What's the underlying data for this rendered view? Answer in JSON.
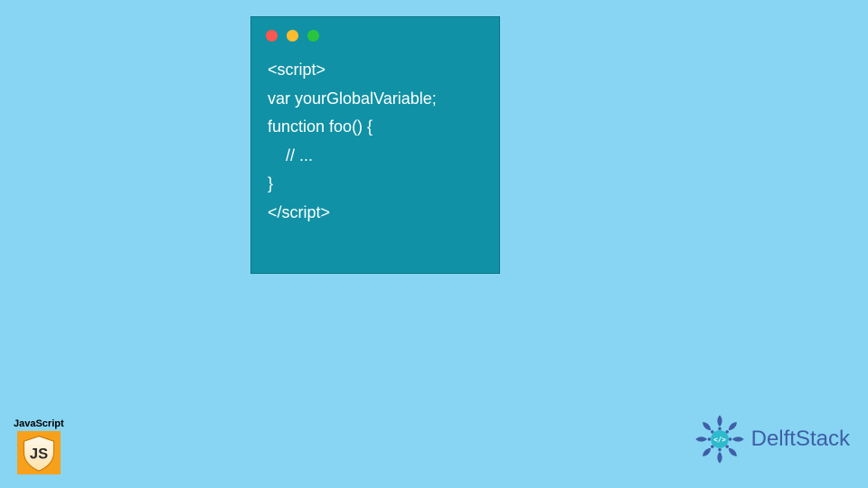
{
  "code": {
    "lines": [
      "<script>",
      "var yourGlobalVariable;",
      "function foo() {",
      "    // ...",
      "}",
      "</script>"
    ]
  },
  "jsLogo": {
    "label": "JavaScript",
    "badge": "JS"
  },
  "delft": {
    "text": "DelftStack"
  },
  "colors": {
    "bg": "#87d5f2",
    "windowBg": "#1091a5",
    "dotRed": "#f85851",
    "dotYellow": "#fdbc2e",
    "dotGreen": "#2bc43f",
    "jsOrange": "#f7a01b",
    "delftBlue": "#3e5ea8"
  }
}
